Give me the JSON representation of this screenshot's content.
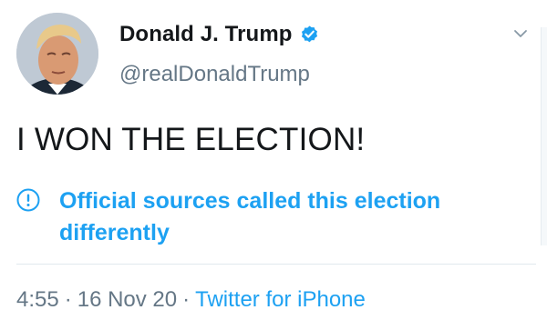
{
  "tweet": {
    "author": {
      "display_name": "Donald J. Trump",
      "handle": "@realDonaldTrump",
      "verified": true
    },
    "text": "I WON THE ELECTION!",
    "notice": {
      "text": "Official sources called this election differently",
      "icon": "exclamation-circle-icon"
    },
    "meta": {
      "time": "4:55",
      "separator": "·",
      "date": "16 Nov 20",
      "source": "Twitter for iPhone"
    }
  },
  "colors": {
    "accent": "#1da1f2",
    "primary_text": "#14171a",
    "secondary_text": "#657786",
    "divider": "#e1e8ed"
  }
}
